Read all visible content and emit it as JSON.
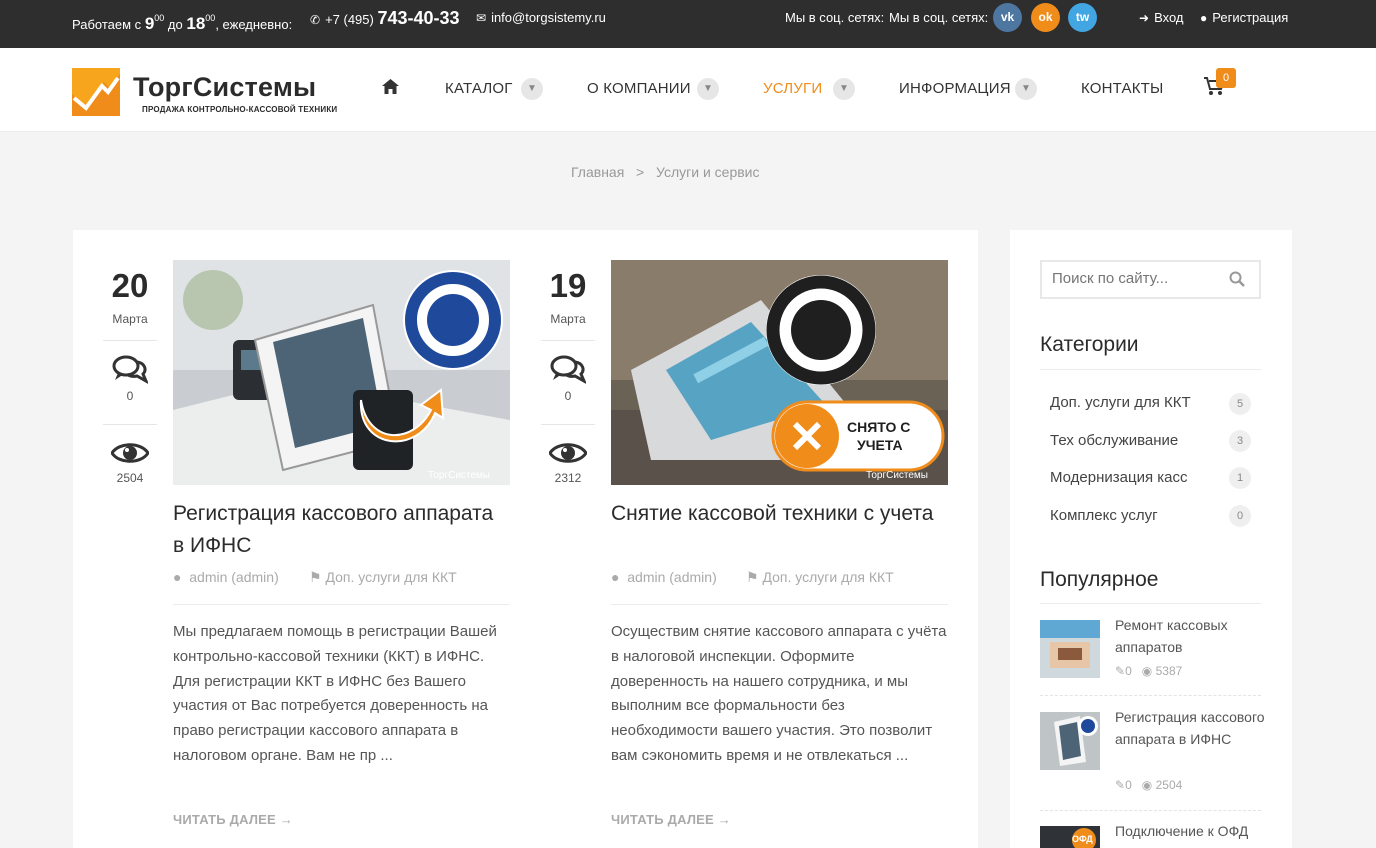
{
  "topbar": {
    "hours_prefix": "Работаем с",
    "hours_from": "9",
    "hours_from_min": "00",
    "hours_to_word": "до",
    "hours_to": "18",
    "hours_to_min": "00",
    "hours_suffix": ", ежедневно:",
    "phone_code": "+7 (495)",
    "phone_number": "743-40-33",
    "email": "info@torgsistemy.ru",
    "social_label_1": "Мы в соц. сетях:",
    "social_label_2": "Мы в соц. сетях:",
    "social": [
      {
        "name": "vk",
        "label": "vk",
        "color": "#4d76a1"
      },
      {
        "name": "ok",
        "label": "ok",
        "color": "#f08c1a"
      },
      {
        "name": "twitter",
        "label": "tw",
        "color": "#41a6e2"
      }
    ],
    "login": "Вход",
    "register": "Регистрация"
  },
  "header": {
    "logo_title": "ТоргСистемы",
    "logo_subtitle": "ПРОДАЖА КОНТРОЛЬНО-КАССОВОЙ ТЕХНИКИ",
    "nav": [
      {
        "label": "КАТАЛОГ",
        "has_dropdown": true
      },
      {
        "label": "О КОМПАНИИ",
        "has_dropdown": true
      },
      {
        "label": "УСЛУГИ",
        "has_dropdown": true,
        "active": true
      },
      {
        "label": "ИНФОРМАЦИЯ",
        "has_dropdown": true
      },
      {
        "label": "КОНТАКТЫ",
        "has_dropdown": false
      }
    ],
    "cart_count": "0",
    "accent_color": "#f08c1a"
  },
  "breadcrumb": {
    "home": "Главная",
    "separator": ">",
    "current": "Услуги и сервис"
  },
  "posts": [
    {
      "day": "20",
      "month": "Марта",
      "comments": "0",
      "views": "2504",
      "title": "Регистрация кассового аппарата в ИФНС",
      "author": "admin (admin)",
      "category": "Доп. услуги для ККТ",
      "excerpt": "Мы предлагаем помощь в регистрации Вашей контрольно-кассовой техники (ККТ) в ИФНС. Для регистрации ККТ в ИФНС без Вашего участия от Вас потребуется доверенность на право регистрации кассового аппарата в налоговом органе. Вам не пр ...",
      "read_more": "ЧИТАТЬ ДАЛЕЕ →",
      "image_watermark": "ТоргСистемы"
    },
    {
      "day": "19",
      "month": "Марта",
      "comments": "0",
      "views": "2312",
      "title": "Снятие кассовой техники с учета",
      "author": "admin (admin)",
      "category": "Доп. услуги для ККТ",
      "excerpt": "Осуществим снятие кассового аппарата с учёта в налоговой инспекции. Оформите доверенность на нашего сотрудника, и мы выполним все формальности без необходимости вашего участия. Это позволит вам сэкономить время и не отвлекаться ...",
      "read_more": "ЧИТАТЬ ДАЛЕЕ →",
      "image_badge": "СНЯТО С УЧЕТА",
      "image_watermark": "ТоргСистемы"
    }
  ],
  "sidebar": {
    "search_placeholder": "Поиск по сайту...",
    "categories_title": "Категории",
    "categories": [
      {
        "label": "Доп. услуги для ККТ",
        "count": "5"
      },
      {
        "label": "Тех обслуживание",
        "count": "3"
      },
      {
        "label": "Модернизация касс",
        "count": "1"
      },
      {
        "label": "Комплекс услуг",
        "count": "0"
      }
    ],
    "popular_title": "Популярное",
    "popular": [
      {
        "title": "Ремонт кассовых аппаратов",
        "comments": "0",
        "views": "5387"
      },
      {
        "title": "Регистрация кассового аппарата в ИФНС",
        "comments": "0",
        "views": "2504"
      },
      {
        "title": "Подключение к ОФД",
        "badge": "ОФД"
      }
    ]
  }
}
